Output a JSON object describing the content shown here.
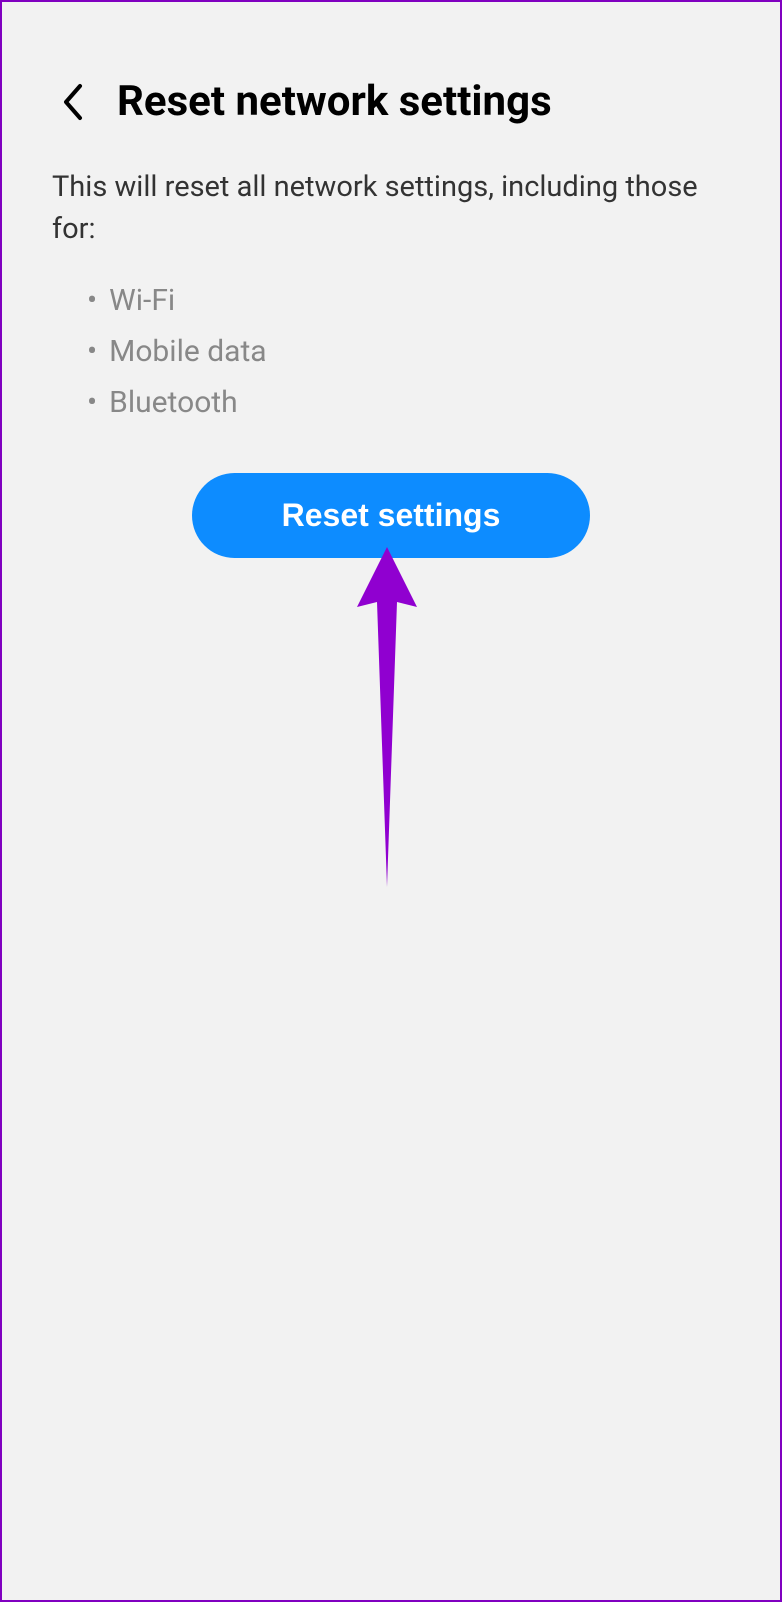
{
  "header": {
    "title": "Reset network settings"
  },
  "description": "This will reset all network settings, including those for:",
  "list": {
    "items": [
      "Wi-Fi",
      "Mobile data",
      "Bluetooth"
    ]
  },
  "button": {
    "reset_label": "Reset settings"
  }
}
